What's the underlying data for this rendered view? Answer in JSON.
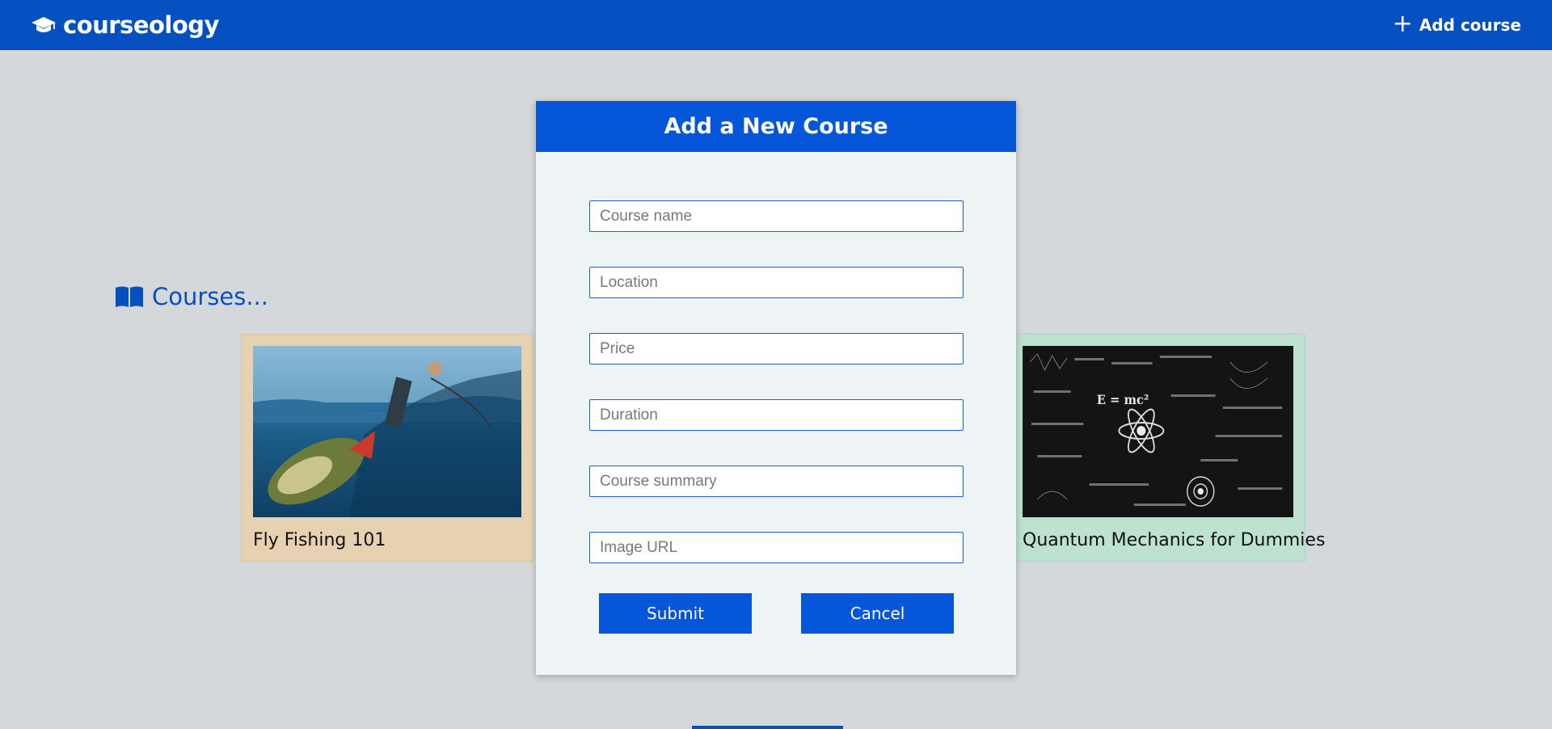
{
  "header": {
    "brand": "courseology",
    "brand_icon": "graduation-cap-icon",
    "add_course_label": "Add course",
    "color": "#0550c0"
  },
  "courses": {
    "heading": "Courses...",
    "heading_icon": "open-book-icon",
    "items": [
      {
        "title": "Fly Fishing 101",
        "image": "fly-fishing-image",
        "card_color": "#e6d1b0"
      },
      {
        "title": "Quantum Mechanics for Dummies",
        "image": "quantum-mechanics-image",
        "card_color": "#bde2cf"
      }
    ]
  },
  "modal": {
    "title": "Add a New Course",
    "fields": [
      {
        "placeholder": "Course name",
        "value": ""
      },
      {
        "placeholder": "Location",
        "value": ""
      },
      {
        "placeholder": "Price",
        "value": ""
      },
      {
        "placeholder": "Duration",
        "value": ""
      },
      {
        "placeholder": "Course summary",
        "value": ""
      },
      {
        "placeholder": "Image URL",
        "value": ""
      }
    ],
    "submit_label": "Submit",
    "cancel_label": "Cancel",
    "accent": "#0556d8"
  }
}
